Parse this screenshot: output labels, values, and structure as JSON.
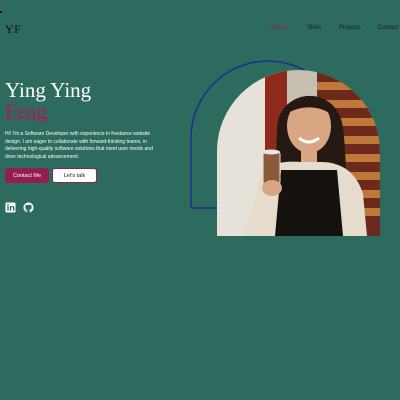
{
  "header": {
    "logo": "YF",
    "nav": [
      {
        "label": "Home",
        "active": true
      },
      {
        "label": "Skills",
        "active": false
      },
      {
        "label": "Projects",
        "active": false
      },
      {
        "label": "Contact",
        "active": false
      }
    ]
  },
  "hero": {
    "first_line": "Ying Ying",
    "second_line": "Feng",
    "bio": "Hi! I'm a Software Developer with experience in freelance website design. I am eager to collaborate with forward-thinking teams, in delivering high-quality software solutions that meet user needs and drive technological advancement.",
    "contact_button": "Contact Me",
    "talk_button": "Let's talk"
  },
  "social": {
    "linkedin_icon": "linkedin-icon",
    "github_icon": "github-icon"
  },
  "colors": {
    "background": "#2e6b5f",
    "accent": "#a0205a",
    "nav_active": "#9b1a52",
    "arch_outline": "#1a2d8f"
  }
}
